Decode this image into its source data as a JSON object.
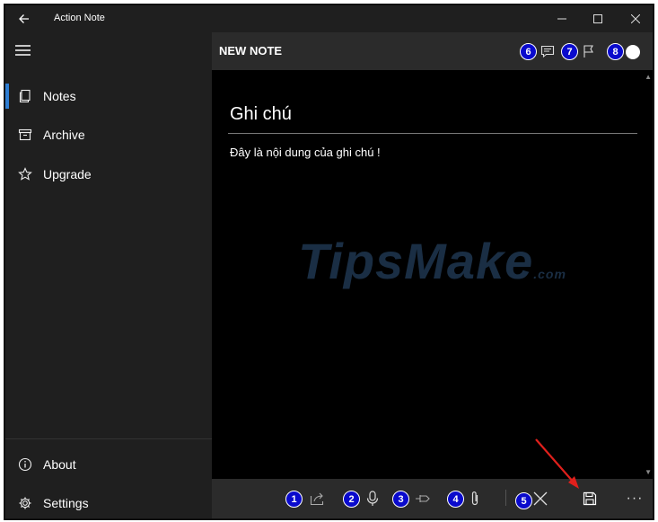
{
  "window": {
    "title": "Action Note"
  },
  "sidebar": {
    "items": [
      {
        "label": "Notes",
        "icon": "notes-icon",
        "active": true
      },
      {
        "label": "Archive",
        "icon": "archive-icon"
      },
      {
        "label": "Upgrade",
        "icon": "star-icon"
      }
    ],
    "bottom_items": [
      {
        "label": "About",
        "icon": "info-icon"
      },
      {
        "label": "Settings",
        "icon": "gear-icon"
      }
    ]
  },
  "header": {
    "title": "NEW NOTE"
  },
  "note": {
    "title": "Ghi chú",
    "body": "Đây là nội dung của ghi chú !"
  },
  "watermark": {
    "text": "TipsMake",
    "suffix": ".com"
  },
  "annotations": {
    "badges": [
      "1",
      "2",
      "3",
      "4",
      "5",
      "6",
      "7",
      "8"
    ],
    "badge_color": "#0a0acc",
    "arrow_color": "#e0201c"
  },
  "colors": {
    "accent": "#2d7dd2",
    "chrome": "#1f1f1f",
    "header": "#2b2b2b",
    "editor": "#000000"
  }
}
